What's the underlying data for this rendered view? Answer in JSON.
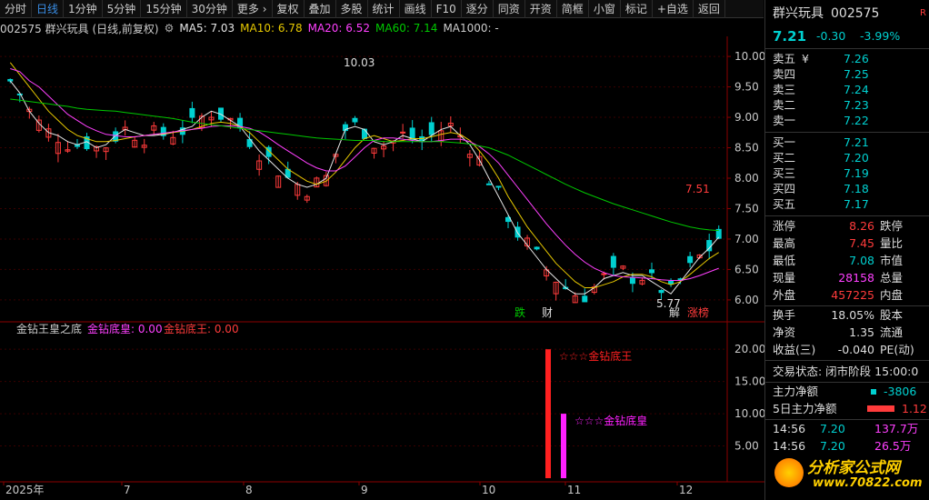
{
  "toolbar": {
    "periods": [
      "分时",
      "日线",
      "1分钟",
      "5分钟",
      "15分钟",
      "30分钟",
      "更多 ›"
    ],
    "active_period": "日线",
    "tools": [
      "复权",
      "叠加",
      "多股",
      "统计",
      "画线",
      "F10",
      "逐分",
      "同资",
      "开资",
      "简框",
      "小窗",
      "标记",
      "+自选",
      "返回"
    ]
  },
  "header": {
    "stock_line": "002575 群兴玩具 (日线,前复权)",
    "ma5": "MA5: 7.03",
    "ma10": "MA10: 6.78",
    "ma20": "MA20: 6.52",
    "ma60": "MA60: 7.14",
    "ma1000": "MA1000: -",
    "diamond": "◇"
  },
  "colors": {
    "up": "#ff3b3b",
    "down": "#00d0d0",
    "ma5": "#e6e6e6",
    "ma10": "#e6c800",
    "ma20": "#ff40ff",
    "ma60": "#00c800",
    "grid": "#8b0000"
  },
  "chart_data": [
    {
      "type": "candlestick",
      "y_ticks": [
        "10.00",
        "9.50",
        "9.00",
        "8.50",
        "8.00",
        "7.50",
        "7.00",
        "6.50",
        "6.00"
      ],
      "ylim": [
        5.7,
        10.3
      ],
      "x_labels": [
        "2025年",
        "7",
        "8",
        "9",
        "10",
        "11",
        "12"
      ],
      "annotations": {
        "high": "10.03",
        "low": "5.77",
        "last_high": "7.51"
      },
      "markers": [
        "跌",
        "财",
        "解",
        "涨榜"
      ],
      "series": [
        {
          "name": "MA5",
          "values": [
            9.6,
            9.4,
            9.1,
            8.9,
            8.75,
            8.7,
            8.6,
            8.55,
            8.6,
            8.5,
            8.55,
            8.7,
            8.8,
            8.75,
            8.7,
            8.7,
            8.72,
            8.75,
            8.8,
            8.85,
            9.0,
            9.1,
            9.05,
            8.95,
            8.85,
            8.65,
            8.45,
            8.3,
            8.15,
            8.0,
            7.9,
            7.85,
            7.9,
            8.0,
            8.4,
            8.8,
            8.85,
            8.8,
            8.6,
            8.55,
            8.6,
            8.7,
            8.65,
            8.6,
            8.7,
            8.8,
            8.85,
            8.7,
            8.55,
            8.3,
            8.0,
            7.7,
            7.4,
            7.1,
            6.9,
            6.7,
            6.5,
            6.35,
            6.2,
            6.1,
            6.1,
            6.2,
            6.35,
            6.4,
            6.45,
            6.4,
            6.4,
            6.3,
            6.2,
            6.1,
            6.3,
            6.5,
            6.7,
            6.85,
            7.03
          ]
        },
        {
          "name": "MA10",
          "values": [
            9.9,
            9.7,
            9.5,
            9.3,
            9.1,
            8.95,
            8.8,
            8.7,
            8.65,
            8.6,
            8.6,
            8.62,
            8.65,
            8.68,
            8.7,
            8.72,
            8.73,
            8.75,
            8.77,
            8.8,
            8.85,
            8.9,
            8.92,
            8.9,
            8.85,
            8.75,
            8.6,
            8.45,
            8.3,
            8.15,
            8.05,
            7.95,
            7.9,
            7.95,
            8.1,
            8.3,
            8.5,
            8.65,
            8.7,
            8.65,
            8.6,
            8.62,
            8.65,
            8.65,
            8.68,
            8.72,
            8.75,
            8.72,
            8.62,
            8.45,
            8.25,
            8.0,
            7.7,
            7.45,
            7.2,
            7.0,
            6.8,
            6.6,
            6.45,
            6.3,
            6.2,
            6.2,
            6.25,
            6.3,
            6.38,
            6.42,
            6.42,
            6.38,
            6.3,
            6.25,
            6.3,
            6.42,
            6.55,
            6.68,
            6.78
          ]
        },
        {
          "name": "MA20",
          "values": [
            9.8,
            9.75,
            9.6,
            9.5,
            9.35,
            9.2,
            9.05,
            8.95,
            8.85,
            8.78,
            8.72,
            8.7,
            8.68,
            8.68,
            8.7,
            8.72,
            8.74,
            8.76,
            8.78,
            8.8,
            8.82,
            8.85,
            8.86,
            8.86,
            8.85,
            8.82,
            8.76,
            8.66,
            8.55,
            8.45,
            8.35,
            8.25,
            8.17,
            8.12,
            8.12,
            8.2,
            8.35,
            8.5,
            8.62,
            8.66,
            8.66,
            8.64,
            8.62,
            8.6,
            8.6,
            8.62,
            8.64,
            8.64,
            8.6,
            8.52,
            8.4,
            8.25,
            8.05,
            7.85,
            7.65,
            7.45,
            7.25,
            7.07,
            6.9,
            6.75,
            6.62,
            6.52,
            6.45,
            6.4,
            6.38,
            6.37,
            6.36,
            6.35,
            6.33,
            6.32,
            6.32,
            6.35,
            6.4,
            6.46,
            6.52
          ]
        },
        {
          "name": "MA60",
          "values": [
            9.3,
            9.28,
            9.26,
            9.24,
            9.22,
            9.2,
            9.18,
            9.15,
            9.13,
            9.12,
            9.11,
            9.1,
            9.08,
            9.06,
            9.04,
            9.02,
            9.0,
            8.98,
            8.95,
            8.92,
            8.9,
            8.88,
            8.86,
            8.84,
            8.82,
            8.8,
            8.78,
            8.76,
            8.74,
            8.72,
            8.7,
            8.68,
            8.66,
            8.65,
            8.64,
            8.63,
            8.62,
            8.62,
            8.62,
            8.6,
            8.6,
            8.6,
            8.6,
            8.6,
            8.6,
            8.6,
            8.59,
            8.58,
            8.56,
            8.53,
            8.5,
            8.44,
            8.38,
            8.3,
            8.22,
            8.14,
            8.06,
            7.98,
            7.9,
            7.83,
            7.76,
            7.7,
            7.64,
            7.58,
            7.53,
            7.48,
            7.43,
            7.38,
            7.33,
            7.28,
            7.24,
            7.2,
            7.17,
            7.15,
            7.14
          ]
        }
      ]
    },
    {
      "type": "bar",
      "title": "金钻王皇之底",
      "legend": [
        "金钻底皇: 0.00",
        "金钻底王: 0.00"
      ],
      "y_ticks": [
        "20.00",
        "15.00",
        "10.00",
        "5.00"
      ],
      "ylim": [
        0,
        22
      ],
      "bars": [
        {
          "name": "金钻底王",
          "x_index": 56,
          "value": 20,
          "label": "☆☆☆金钻底王",
          "color": "#ff2020"
        },
        {
          "name": "金钻底皇",
          "x_index": 58,
          "value": 10,
          "label": "☆☆☆金钻底皇",
          "color": "#ff20ff"
        }
      ]
    }
  ],
  "quote": {
    "name": "群兴玩具",
    "code": "002575",
    "flag": "R",
    "price": "7.21",
    "change": "-0.30",
    "change_pct": "-3.99%",
    "sell": [
      {
        "label": "卖五",
        "price": "7.26",
        "vol": "",
        "yen": "¥"
      },
      {
        "label": "卖四",
        "price": "7.25",
        "vol": ""
      },
      {
        "label": "卖三",
        "price": "7.24",
        "vol": ""
      },
      {
        "label": "卖二",
        "price": "7.23",
        "vol": ""
      },
      {
        "label": "卖一",
        "price": "7.22",
        "vol": ""
      }
    ],
    "buy": [
      {
        "label": "买一",
        "price": "7.21",
        "vol": ""
      },
      {
        "label": "买二",
        "price": "7.20",
        "vol": ""
      },
      {
        "label": "买三",
        "price": "7.19",
        "vol": ""
      },
      {
        "label": "买四",
        "price": "7.18",
        "vol": ""
      },
      {
        "label": "买五",
        "price": "7.17",
        "vol": ""
      }
    ],
    "stats": [
      {
        "label": "涨停",
        "value": "8.26",
        "label2": "跌停"
      },
      {
        "label": "最高",
        "value": "7.45",
        "label2": "量比"
      },
      {
        "label": "最低",
        "value": "7.08",
        "label2": "市值"
      },
      {
        "label": "现量",
        "value": "28158",
        "label2": "总量"
      },
      {
        "label": "外盘",
        "value": "457225",
        "label2": "内盘"
      }
    ],
    "stats2": [
      {
        "label": "换手",
        "value": "18.05%",
        "label2": "股本"
      },
      {
        "label": "净资",
        "value": "1.35",
        "label2": "流通"
      },
      {
        "label": "收益(三)",
        "value": "-0.040",
        "label2": "PE(动)"
      }
    ],
    "status_line": "交易状态: 闭市阶段 15:00:0",
    "main_net": {
      "label": "主力净额",
      "value": "-3806"
    },
    "five_day_net": {
      "label": "5日主力净额",
      "value": "1.12"
    },
    "ticks": [
      {
        "time": "14:56",
        "price": "7.20",
        "vol": "137.7万"
      },
      {
        "time": "14:56",
        "price": "7.20",
        "vol": "26.5万"
      }
    ]
  },
  "watermark": {
    "site": "分析家公式网",
    "url": "www.70822.com"
  }
}
